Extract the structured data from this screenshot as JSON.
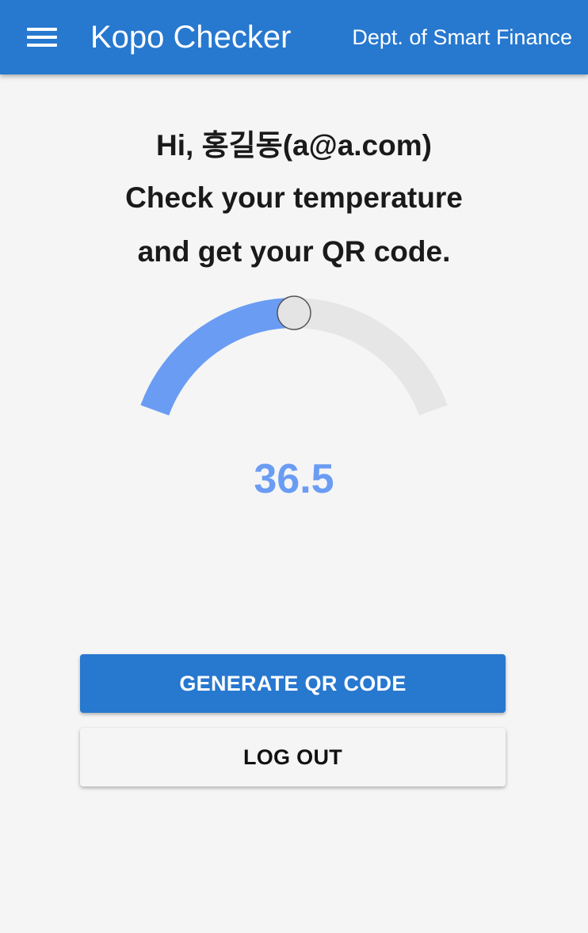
{
  "app": {
    "title": "Kopo Checker",
    "subtitle": "Dept. of Smart Finance",
    "menu_icon": "hamburger-menu-icon"
  },
  "greeting": {
    "line1": "Hi, 홍길동(a@a.com)",
    "line2": "Check your temperature",
    "line3": "and get your QR code."
  },
  "temperature": {
    "value": "36.5",
    "slider_fraction": 0.5
  },
  "buttons": {
    "generate_qr": "GENERATE QR CODE",
    "logout": "LOG OUT"
  },
  "colors": {
    "primary": "#2778cf",
    "gauge_fill": "#6a9cf4",
    "gauge_track": "#e6e6e6",
    "background": "#f5f5f5"
  }
}
